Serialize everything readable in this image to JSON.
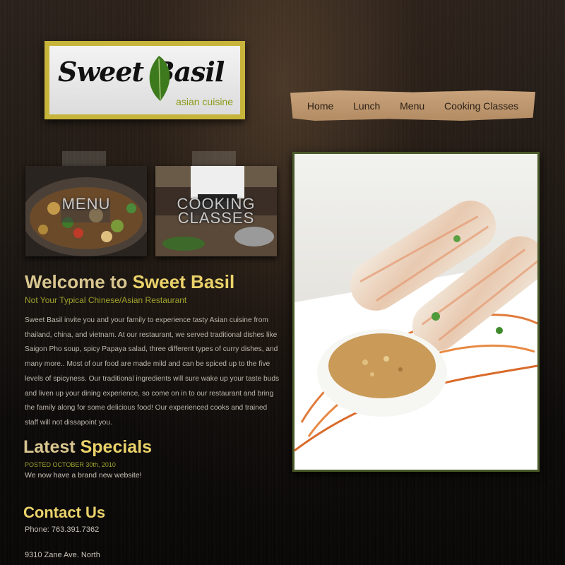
{
  "logo": {
    "name": "Sweet Basil",
    "sub": "asian cuisine"
  },
  "nav": {
    "items": [
      "Home",
      "Lunch",
      "Menu",
      "Cooking Classes"
    ]
  },
  "thumbs": {
    "menu_label": "MENU",
    "classes_label_1": "COOKING",
    "classes_label_2": "CLASSES"
  },
  "welcome": {
    "title_prefix": "Welcome to",
    "title_accent": "Sweet Basil",
    "tagline": "Not Your Typical Chinese/Asian Restaurant",
    "body": "Sweet Basil invite you and your family to experience tasty Asian cuisine from thailand, china, and vietnam. At our restaurant, we served traditional dishes like Saigon Pho soup, spicy Papaya salad, three different types of curry dishes, and many more.. Most of our food are made mild and can be spiced up to the five levels of spicyness. Our traditional ingredients will sure wake up your taste buds and liven up your dining experience, so come on in to our restaurant and bring the family along for some delicious food! Our experienced cooks and trained staff will not dissapoint you."
  },
  "specials": {
    "title_prefix": "Latest",
    "title_accent": "Specials",
    "posted": "POSTED OCTOBER 30th, 2010",
    "text": "We now have a brand new website!"
  },
  "contact": {
    "title": "Contact Us",
    "phone": "Phone: 763.391.7362",
    "address": "9310 Zane Ave. North"
  },
  "colors": {
    "accent_gold": "#ead26a",
    "tagline_green": "#9ea22c",
    "logo_frame": "#c7b43b"
  }
}
